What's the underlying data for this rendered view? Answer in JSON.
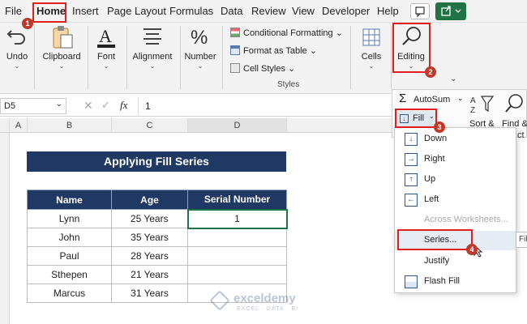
{
  "menu": [
    "File",
    "Home",
    "Insert",
    "Page Layout",
    "Formulas",
    "Data",
    "Review",
    "View",
    "Developer",
    "Help"
  ],
  "ribbon": {
    "undo": "Undo",
    "clipboard": "Clipboard",
    "font": "Font",
    "alignment": "Alignment",
    "number": "Number",
    "styles_items": [
      "Conditional Formatting",
      "Format as Table",
      "Cell Styles"
    ],
    "styles_group": "Styles",
    "cells": "Cells",
    "editing": "Editing"
  },
  "formula_bar": {
    "name_box": "D5",
    "fx": "fx",
    "value": "1"
  },
  "columns": [
    "A",
    "B",
    "C",
    "D"
  ],
  "sheet": {
    "title": "Applying Fill Series",
    "headers": [
      "Name",
      "Age",
      "Serial Number"
    ],
    "rows": [
      [
        "Lynn",
        "25 Years",
        "1"
      ],
      [
        "John",
        "35 Years",
        ""
      ],
      [
        "Paul",
        "28 Years",
        ""
      ],
      [
        "Sthepen",
        "21 Years",
        ""
      ],
      [
        "Marcus",
        "31 Years",
        ""
      ]
    ]
  },
  "editing_panel": {
    "autosum": "AutoSum",
    "fill": "Fill",
    "sort": "Sort &",
    "find": "Find &",
    "clip": "ct"
  },
  "fill_menu": [
    "Down",
    "Right",
    "Up",
    "Left",
    "Across Worksheets...",
    "Series...",
    "Justify",
    "Flash Fill"
  ],
  "tooltip_clip": "Fil",
  "steps": [
    "1",
    "2",
    "3",
    "4"
  ],
  "watermark": {
    "name": "exceldemy",
    "tag": "EXCEL · DATA · BI"
  },
  "colors": {
    "accent_red": "#e02020",
    "header_blue": "#1f3864",
    "excel_green": "#217346"
  }
}
